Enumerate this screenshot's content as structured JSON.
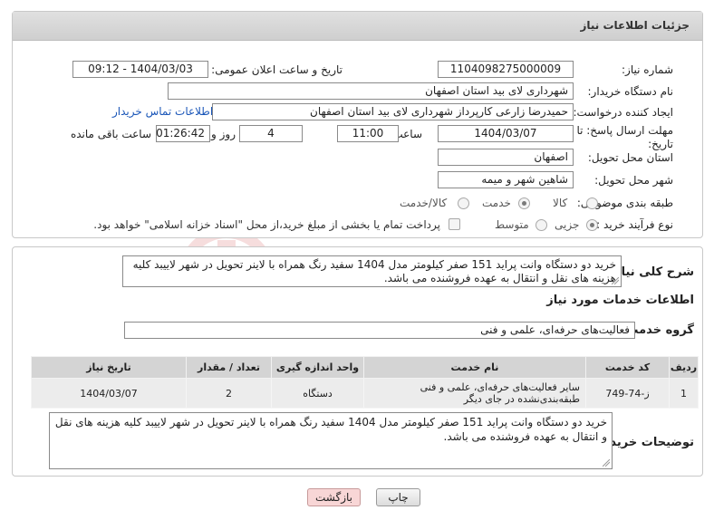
{
  "header": {
    "title": "جزئیات اطلاعات نیاز"
  },
  "form": {
    "need_number_label": "شماره نیاز:",
    "need_number": "1104098275000009",
    "announce_label": "تاریخ و ساعت اعلان عمومی:",
    "announce_value": "1404/03/03 - 09:12",
    "buyer_org_label": "نام دستگاه خریدار:",
    "buyer_org": "شهرداری لای بید استان اصفهان",
    "requester_label": "ایجاد کننده درخواست:",
    "requester": "حمیدرضا زارعی کارپرداز شهرداری لای بید استان اصفهان",
    "contact_link": "اطلاعات تماس خریدار",
    "deadline_label": "مهلت ارسال پاسخ: تا تاریخ:",
    "deadline_date": "1404/03/07",
    "time_label": "ساعت",
    "deadline_time": "11:00",
    "days_value": "4",
    "days_label": "روز و",
    "remaining_time": "01:26:42",
    "remaining_label": "ساعت باقی مانده",
    "province_label": "استان محل تحویل:",
    "province": "اصفهان",
    "city_label": "شهر محل تحویل:",
    "city": "شاهین شهر و میمه",
    "category_label": "طبقه بندی موضوعی:",
    "category_options": [
      "کالا",
      "خدمت",
      "کالا/خدمت"
    ],
    "process_label": "نوع فرآیند خرید :",
    "process_options": [
      "جزیی",
      "متوسط"
    ],
    "payment_note": "پرداخت تمام یا بخشی از مبلغ خرید،از محل \"اسناد خزانه اسلامی\" خواهد بود."
  },
  "summary": {
    "label": "شرح کلی نیاز:",
    "text": "خرید دو دستگاه وانت پراید 151 صفر کیلومتر مدل 1404 سفید رنگ همراه با لاینر تحویل در شهر لاییبد کلیه هزینه های نقل و انتقال به عهده فروشنده می باشد."
  },
  "services": {
    "section_title": "اطلاعات خدمات مورد نیاز",
    "group_label": "گروه خدمت:",
    "group_value": "فعالیت‌های حرفه‌ای، علمی و فنی",
    "table": {
      "headers": [
        "ردیف",
        "کد خدمت",
        "نام خدمت",
        "واحد اندازه گیری",
        "تعداد / مقدار",
        "تاریخ نیاز"
      ],
      "rows": [
        [
          "1",
          "ز-74-749",
          "سایر فعالیت‌های حرفه‌ای، علمی و فنی طبقه‌بندی‌نشده در جای دیگر",
          "دستگاه",
          "2",
          "1404/03/07"
        ]
      ]
    }
  },
  "buyer_notes": {
    "label": "توضیحات خریدار:",
    "text": "خرید دو دستگاه وانت پراید 151 صفر کیلومتر مدل 1404 سفید رنگ همراه با لاینر تحویل در شهر لاییبد کلیه هزینه های نقل و انتقال به عهده فروشنده می باشد."
  },
  "buttons": {
    "print": "چاپ",
    "back": "بازگشت"
  },
  "watermark": "AriaTender.neT"
}
